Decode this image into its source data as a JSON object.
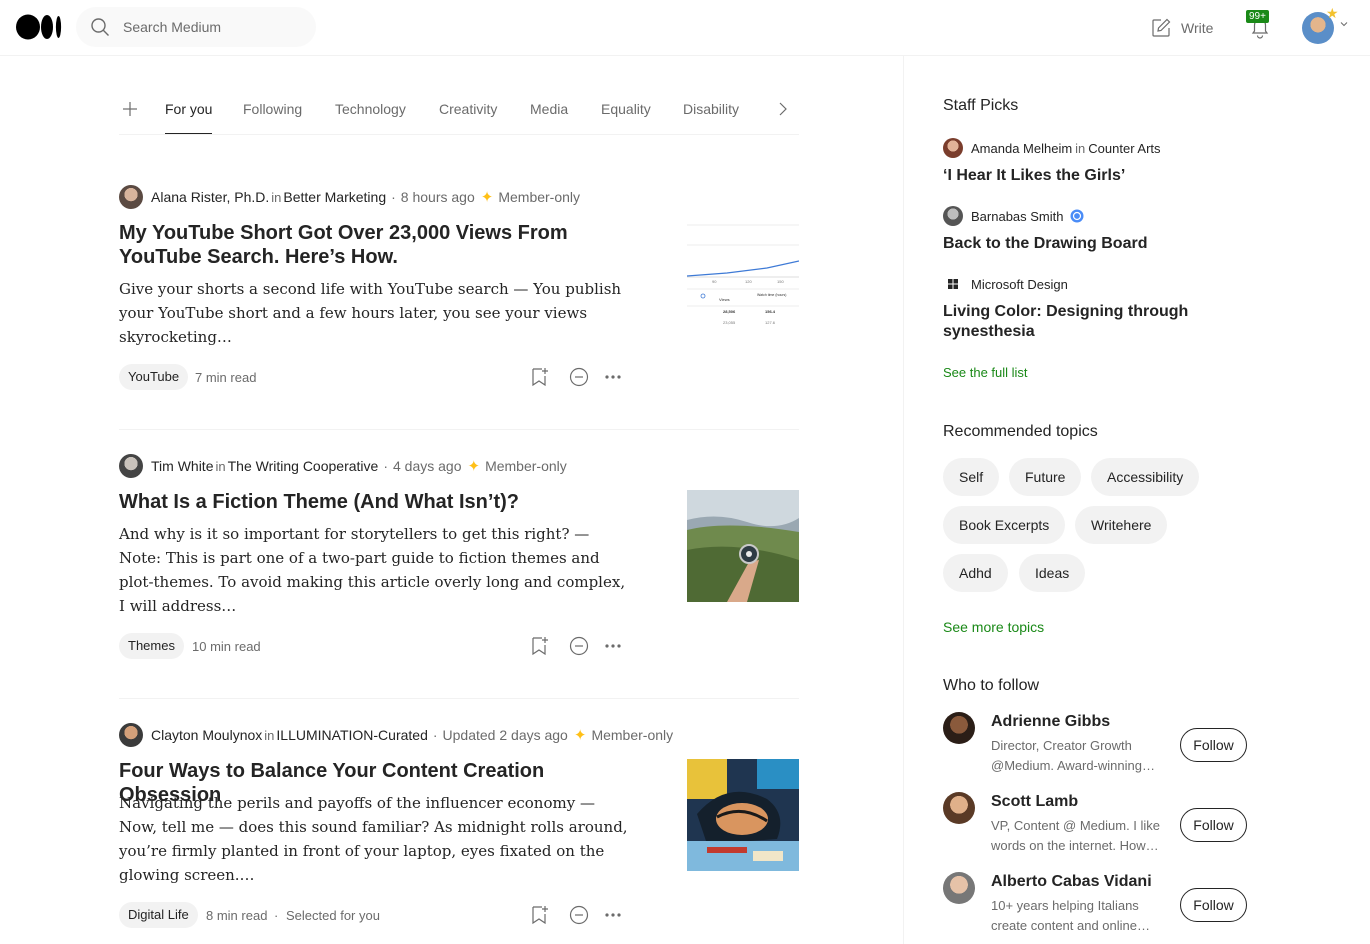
{
  "topbar": {
    "logo_icon": "medium-logo-icon",
    "search_placeholder": "Search Medium",
    "write_label": "Write",
    "notifications_badge": "99+"
  },
  "tabs": [
    "For you",
    "Following",
    "Technology",
    "Creativity",
    "Media",
    "Equality",
    "Disability"
  ],
  "articles": [
    {
      "author": "Alana Rister, Ph.D.",
      "in": "in",
      "publication": "Better Marketing",
      "time": "8 hours ago",
      "member": "Member-only",
      "title": "My YouTube Short Got Over 23,000 Views From YouTube Search. Here’s How.",
      "excerpt": "Give your shorts a second life with YouTube search — You publish your YouTube short and a few hours later, you see your views skyrocketing…",
      "tag": "YouTube",
      "read_time": "7 min read",
      "thumb_text": {
        "views": "Views",
        "watch": "Watch time (hours)",
        "v1": "28,506",
        "v2": "23,055",
        "w1": "156.4",
        "w2": "127.6",
        "ax1": "90",
        "ax2": "120",
        "ax3": "150"
      }
    },
    {
      "author": "Tim White",
      "in": "in",
      "publication": "The Writing Cooperative",
      "time": "4 days ago",
      "member": "Member-only",
      "title": "What Is a Fiction Theme (And What Isn’t)?",
      "excerpt": "And why is it so important for storytellers to get this right? — Note: This is part one of a two-part guide to fiction themes and plot-themes. To avoid making this article overly long and complex, I will address…",
      "tag": "Themes",
      "read_time": "10 min read"
    },
    {
      "author": "Clayton Moulynox",
      "in": "in",
      "publication": "ILLUMINATION-Curated",
      "time": "Updated 2 days ago",
      "member": "Member-only",
      "title": "Four Ways to Balance Your Content Creation Obsession",
      "excerpt": "Navigating the perils and payoffs of the influencer economy — Now, tell me — does this sound familiar? As midnight rolls around, you’re firmly planted in front of your laptop, eyes fixated on the glowing screen.…",
      "tag": "Digital Life",
      "read_time": "8 min read",
      "extra": "Selected for you"
    }
  ],
  "sidebar": {
    "staff_picks_heading": "Staff Picks",
    "picks": [
      {
        "author": "Amanda Melheim",
        "in": "in",
        "publication": "Counter Arts",
        "title": "‘I Hear It Likes the Girls’"
      },
      {
        "author": "Barnabas Smith",
        "title": "Back to the Drawing Board",
        "verified_icon": "verified-badge-icon"
      },
      {
        "author": "Microsoft Design",
        "title": "Living Color: Designing through synesthesia"
      }
    ],
    "see_full_list": "See the full list",
    "topics_heading": "Recommended topics",
    "topics": [
      "Self",
      "Future",
      "Accessibility",
      "Book Excerpts",
      "Writehere",
      "Adhd",
      "Ideas"
    ],
    "see_more_topics": "See more topics",
    "who_to_follow_heading": "Who to follow",
    "follow_label": "Follow",
    "people": [
      {
        "name": "Adrienne Gibbs",
        "bio": "Director, Creator Growth @Medium. Award-winning…"
      },
      {
        "name": "Scott Lamb",
        "bio": "VP, Content @ Medium. I like words on the internet. How…"
      },
      {
        "name": "Alberto Cabas Vidani",
        "bio": "10+ years helping Italians create content and online…"
      }
    ]
  },
  "colors": {
    "accent_green": "#1a8917",
    "member_star": "#ffc017",
    "text": "#242424",
    "muted": "#6b6b6b"
  }
}
